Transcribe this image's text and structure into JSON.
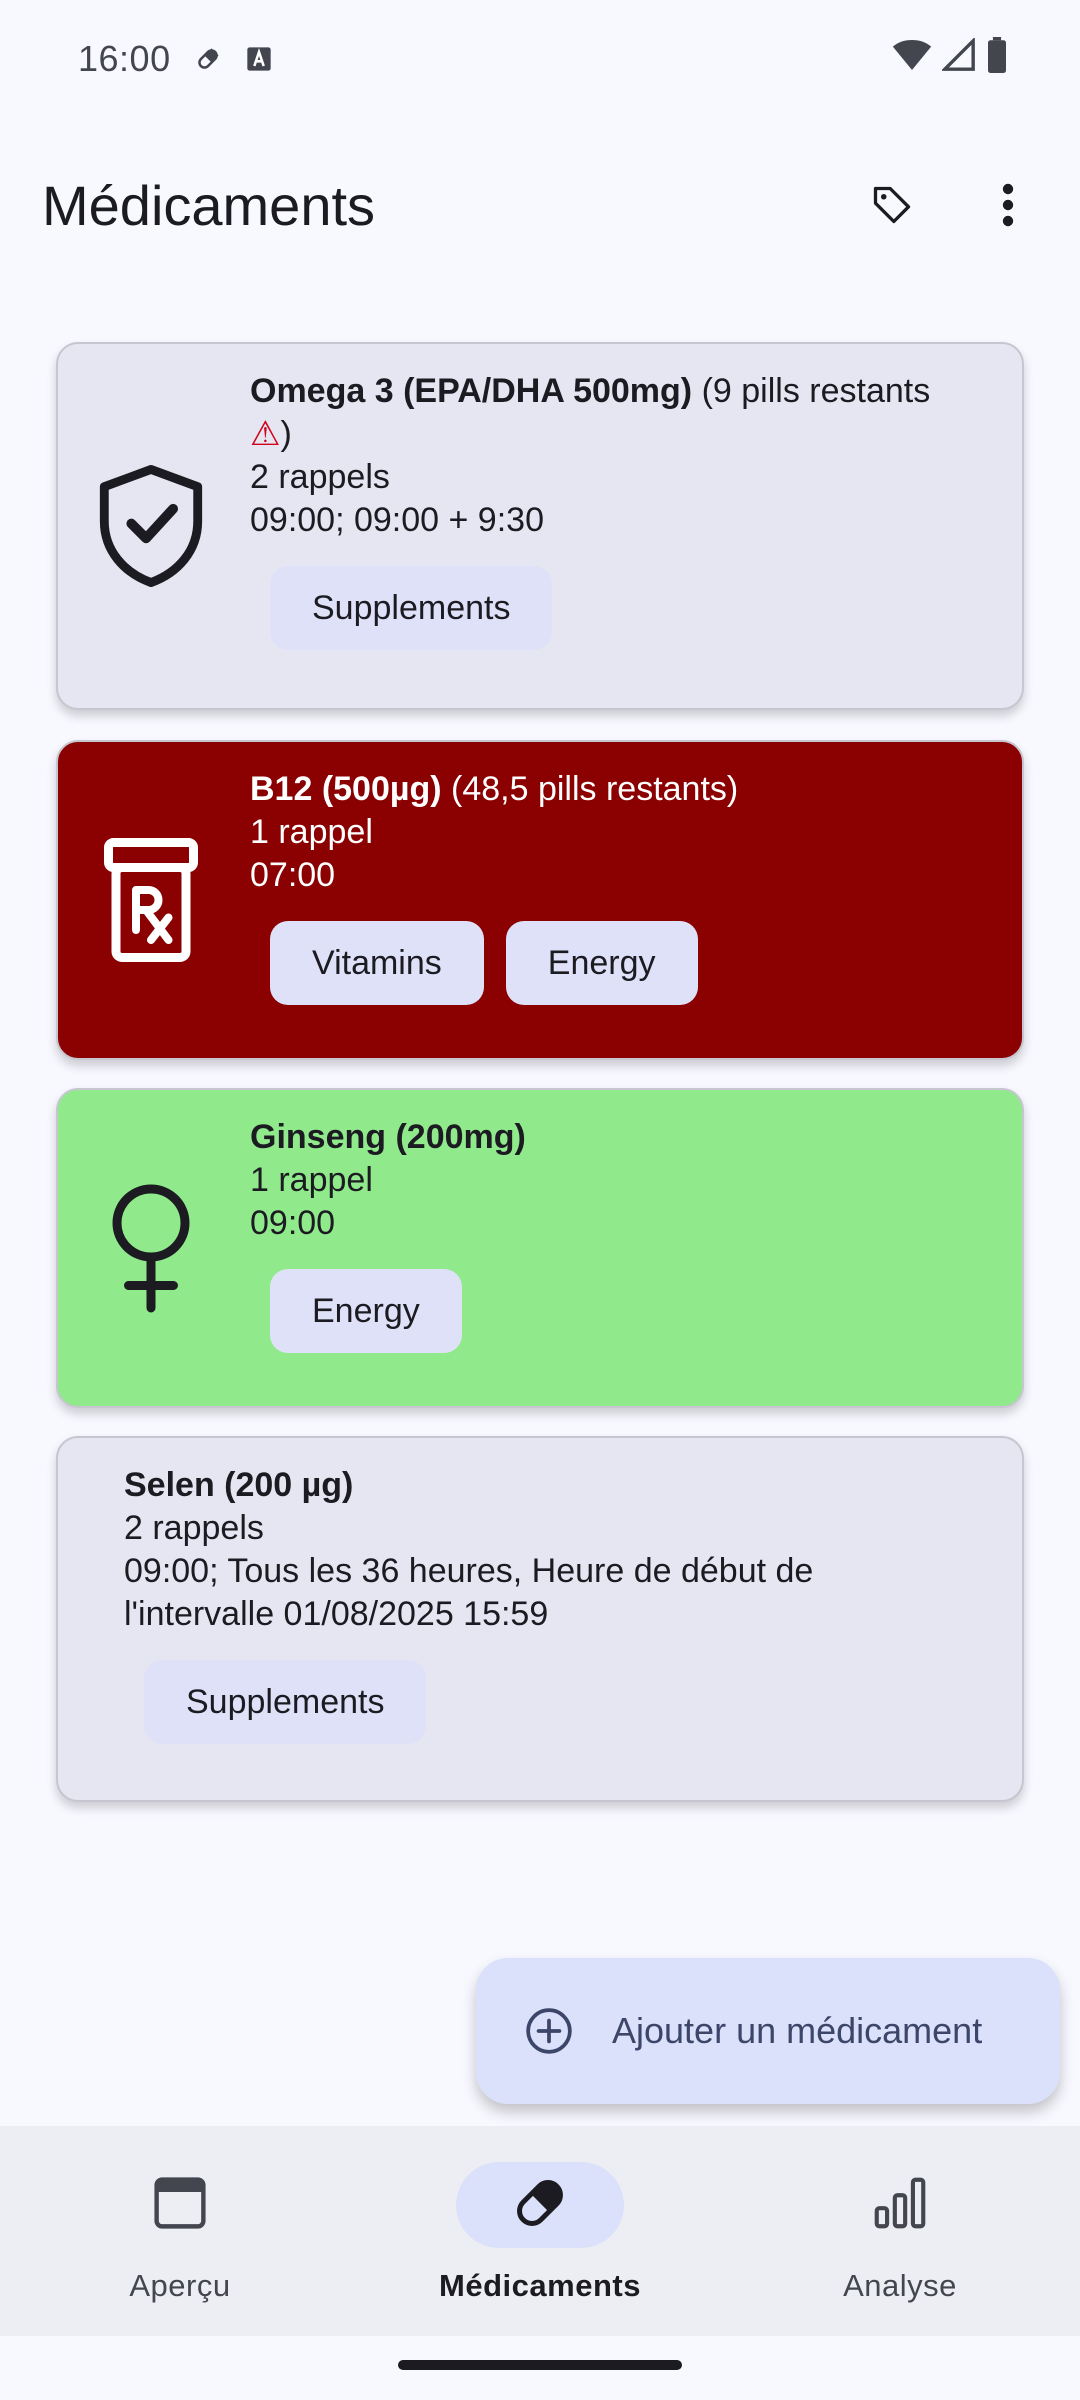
{
  "status_bar": {
    "time": "16:00",
    "icons": [
      "pill-notification-icon",
      "keyboard-a-icon",
      "wifi-icon",
      "signal-icon",
      "battery-icon"
    ]
  },
  "app_bar": {
    "title": "Médicaments",
    "actions": [
      "tag-icon",
      "more-vert-icon"
    ]
  },
  "medications": [
    {
      "name": "Omega 3 (EPA/DHA 500mg)",
      "remaining": " (9 pills restants",
      "warning_symbol": "⚠",
      "remaining_close": ")",
      "reminders": "2 rappels",
      "schedule": "09:00; 09:00 + 9:30",
      "tags": [
        "Supplements"
      ],
      "icon": "shield-check-icon",
      "color": "#e6e6f2"
    },
    {
      "name": "B12 (500µg)",
      "remaining": " (48,5 pills restants)",
      "reminders": "1 rappel",
      "schedule": "07:00",
      "tags": [
        "Vitamins",
        "Energy"
      ],
      "icon": "rx-bottle-icon",
      "color": "#8b0000"
    },
    {
      "name": "Ginseng (200mg)",
      "reminders": "1 rappel",
      "schedule": "09:00",
      "tags": [
        "Energy"
      ],
      "icon": "female-symbol-icon",
      "color": "#90ea8c"
    },
    {
      "name": "Selen (200 µg)",
      "reminders": "2 rappels",
      "schedule_line1": "09:00; Tous les 36 heures, Heure de début de",
      "schedule_line2": "l'intervalle 01/08/2025 15:59",
      "tags": [
        "Supplements"
      ],
      "color": "#e6e6f2"
    }
  ],
  "fab": {
    "label": "Ajouter un médicament",
    "icon": "add-circle-icon"
  },
  "bottom_nav": [
    {
      "label": "Aperçu",
      "icon": "calendar-icon",
      "active": false
    },
    {
      "label": "Médicaments",
      "icon": "pill-icon",
      "active": true
    },
    {
      "label": "Analyse",
      "icon": "bar-chart-icon",
      "active": false
    }
  ]
}
